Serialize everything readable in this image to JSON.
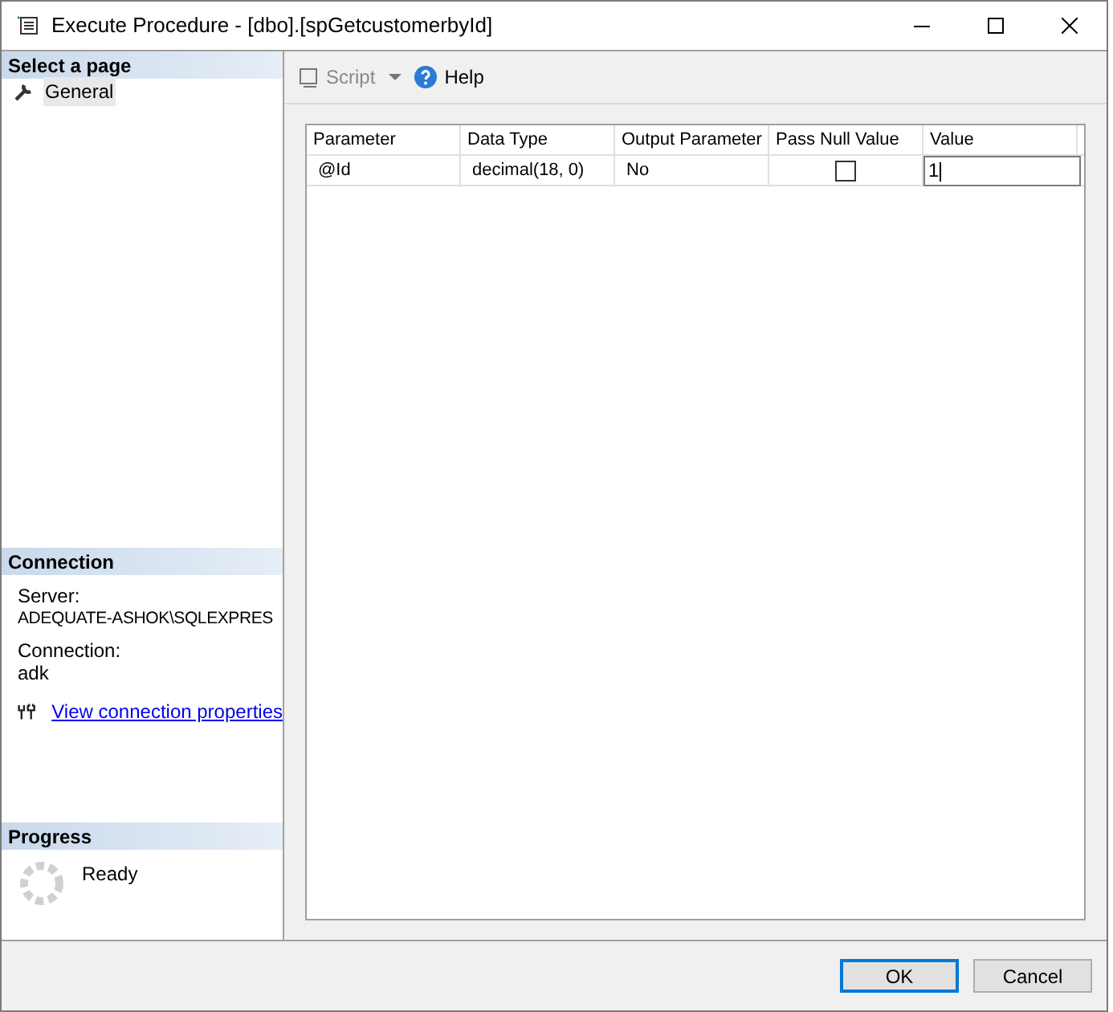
{
  "window": {
    "title": "Execute Procedure - [dbo].[spGetcustomerbyId]"
  },
  "sidebar": {
    "header": "Select a page",
    "items": [
      {
        "label": "General",
        "selected": true
      }
    ]
  },
  "connection": {
    "header": "Connection",
    "server_label": "Server:",
    "server": "ADEQUATE-ASHOK\\SQLEXPRES",
    "connection_label": "Connection:",
    "connection": "adk",
    "link": "View connection properties"
  },
  "progress": {
    "header": "Progress",
    "status": "Ready"
  },
  "toolbar": {
    "script": {
      "label": "Script",
      "disabled": true
    },
    "help": {
      "label": "Help"
    }
  },
  "table": {
    "columns": [
      "Parameter",
      "Data Type",
      "Output Parameter",
      "Pass Null Value",
      "Value"
    ],
    "rows": [
      {
        "parameter": "@Id",
        "data_type": "decimal(18, 0)",
        "output": "No",
        "pass_null": false,
        "value": "1"
      }
    ]
  },
  "buttons": [
    {
      "label": "OK",
      "default": true
    },
    {
      "label": "Cancel",
      "default": false
    }
  ]
}
